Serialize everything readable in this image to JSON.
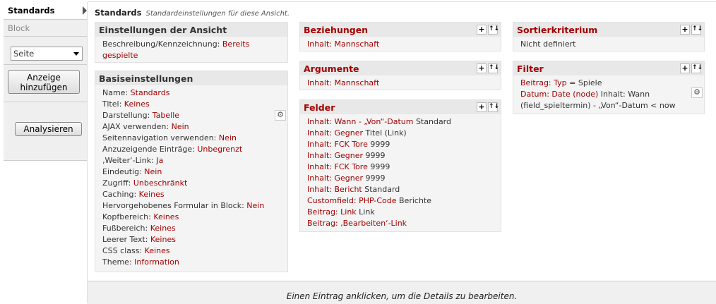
{
  "tabs": {
    "active": "Standards",
    "block": "Block"
  },
  "display_select": {
    "value": "Seite"
  },
  "buttons": {
    "add_display": "Anzeige hinzufügen",
    "analyze": "Analysieren"
  },
  "header": {
    "title": "Standards",
    "subtitle": "Standardeinstellungen für diese Ansicht."
  },
  "view_settings": {
    "title": "Einstellungen der Ansicht",
    "desc_key": "Beschreibung/Kennzeichnung:",
    "desc_val": "Bereits gespielte"
  },
  "basic": {
    "title": "Basiseinstellungen",
    "rows": [
      {
        "k": "Name:",
        "v": "Standards"
      },
      {
        "k": "Titel:",
        "v": "Keines"
      },
      {
        "k": "Darstellung:",
        "v": "Tabelle"
      },
      {
        "k": "AJAX verwenden:",
        "v": "Nein"
      },
      {
        "k": "Seitennavigation verwenden:",
        "v": "Nein"
      },
      {
        "k": "Anzuzeigende Einträge:",
        "v": "Unbegrenzt"
      },
      {
        "k": "‚Weiter‘-Link:",
        "v": "Ja"
      },
      {
        "k": "Eindeutig:",
        "v": "Nein"
      },
      {
        "k": "Zugriff:",
        "v": "Unbeschränkt"
      },
      {
        "k": "Caching:",
        "v": "Keines"
      },
      {
        "k": "Hervorgehobenes Formular in Block:",
        "v": "Nein"
      },
      {
        "k": "Kopfbereich:",
        "v": "Keines"
      },
      {
        "k": "Fußbereich:",
        "v": "Keines"
      },
      {
        "k": "Leerer Text:",
        "v": "Keines"
      },
      {
        "k": "CSS class:",
        "v": "Keines"
      },
      {
        "k": "Theme:",
        "v": "Information"
      }
    ]
  },
  "relationships": {
    "title": "Beziehungen",
    "items": [
      "Inhalt: Mannschaft"
    ]
  },
  "arguments": {
    "title": "Argumente",
    "items": [
      "Inhalt: Mannschaft"
    ]
  },
  "fields": {
    "title": "Felder",
    "items": [
      {
        "link": "Inhalt: Wann - „Von“-Datum",
        "rest": "Standard"
      },
      {
        "link": "Inhalt: Gegner",
        "rest": "Titel (Link)"
      },
      {
        "link": "Inhalt: FCK Tore",
        "rest": "9999"
      },
      {
        "link": "Inhalt: Gegner",
        "rest": "9999"
      },
      {
        "link": "Inhalt: FCK Tore",
        "rest": "9999"
      },
      {
        "link": "Inhalt: Gegner",
        "rest": "9999"
      },
      {
        "link": "Inhalt: Bericht",
        "rest": "Standard"
      },
      {
        "link": "Customfield: PHP-Code",
        "rest": "Berichte"
      },
      {
        "link": "Beitrag: Link",
        "rest": "Link"
      },
      {
        "link": "Beitrag: ‚Bearbeiten‘-Link",
        "rest": ""
      }
    ]
  },
  "sort": {
    "title": "Sortierkriterium",
    "text": "Nicht definiert"
  },
  "filter": {
    "title": "Filter",
    "line1_link": "Beitrag: Typ",
    "line1_rest": "= Spiele",
    "line2_link": "Datum: Date (node)",
    "line2_rest": "Inhalt: Wann",
    "line3": "(field_spieltermin) - „Von“-Datum < now"
  },
  "footer": {
    "text": "Einen Eintrag anklicken, um die Details zu bearbeiten."
  },
  "icons": {
    "plus": "+",
    "sort": "↑↓",
    "gear": "⚙"
  }
}
